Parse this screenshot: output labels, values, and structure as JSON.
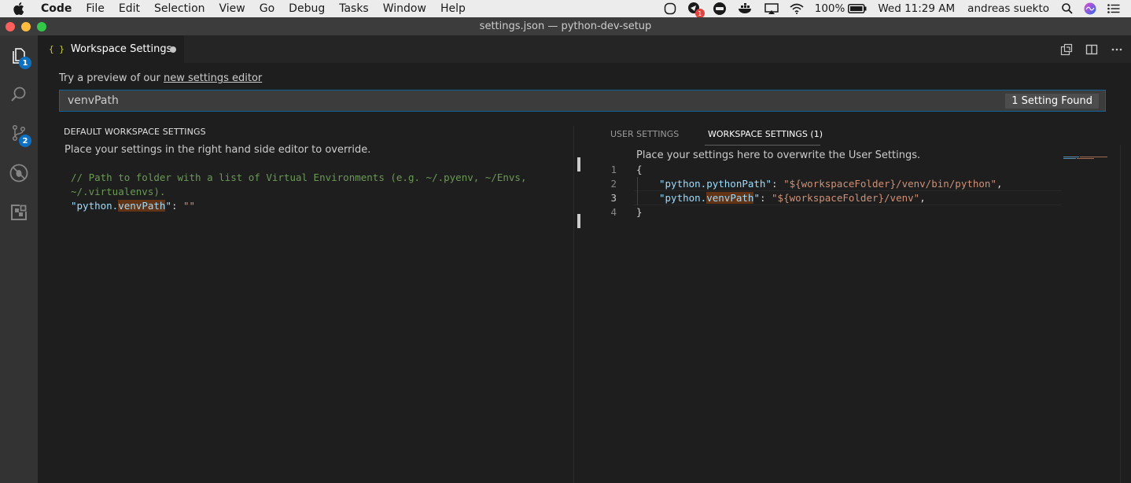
{
  "menubar": {
    "app": "Code",
    "items": [
      "File",
      "Edit",
      "Selection",
      "View",
      "Go",
      "Debug",
      "Tasks",
      "Window",
      "Help"
    ],
    "tray": {
      "battery": "100%",
      "clock": "Wed 11:29 AM",
      "user": "andreas suekto",
      "notif_count": "1"
    }
  },
  "titlebar": {
    "title": "settings.json — python-dev-setup"
  },
  "activitybar": {
    "explorer_badge": "1",
    "scm_badge": "2"
  },
  "tab": {
    "label": "Workspace Settings",
    "icon_text": "{ }"
  },
  "editor": {
    "preview_prefix": "Try a preview of our ",
    "preview_link": "new settings editor",
    "search_value": "venvPath",
    "search_count": "1 Setting Found",
    "left": {
      "header": "DEFAULT WORKSPACE SETTINGS",
      "subtitle": "Place your settings in the right hand side editor to override.",
      "comment_line1": "// Path to folder with a list of Virtual Environments (e.g. ~/.pyenv, ~/Envs,",
      "comment_line2": "~/.virtualenvs).",
      "key_prefix": "\"python.",
      "key_match": "venvPath",
      "key_suffix": "\"",
      "sep": ": ",
      "value": "\"\""
    },
    "right": {
      "tab_user": "USER SETTINGS",
      "tab_workspace": "WORKSPACE SETTINGS (1)",
      "subtitle": "Place your settings here to overwrite the User Settings.",
      "line_numbers": [
        "1",
        "2",
        "3",
        "4"
      ],
      "line1": "{",
      "line2_key": "\"python.pythonPath\"",
      "line2_sep": ": ",
      "line2_value": "\"${workspaceFolder}/venv/bin/python\"",
      "line2_comma": ",",
      "line3_key_prefix": "\"python.",
      "line3_key_match": "venvPath",
      "line3_key_suffix": "\"",
      "line3_sep": ": ",
      "line3_value": "\"${workspaceFolder}/venv\"",
      "line3_comma": ",",
      "line4": "}"
    }
  },
  "colors": {
    "accent": "#0e639c",
    "badge": "#0e70c0",
    "match_highlight": "#623315"
  }
}
